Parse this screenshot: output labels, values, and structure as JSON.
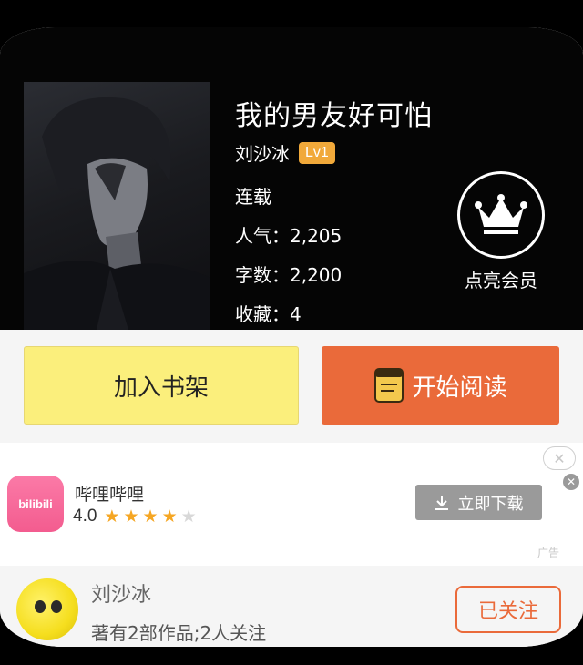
{
  "book": {
    "title": "我的男友好可怕",
    "author": "刘沙冰",
    "level_badge": "Lv1",
    "status": "连载",
    "popularity": "人气：2,205",
    "word_count": "字数：2,200",
    "favorites": "收藏：4",
    "cover_icon": "cover-art"
  },
  "vip": {
    "label": "点亮会员",
    "icon": "crown-icon"
  },
  "actions": {
    "add_shelf_label": "加入书架",
    "start_read_label": "开始阅读",
    "read_icon": "book-icon"
  },
  "ad": {
    "app_icon_text": "bilibili",
    "app_name": "哔哩哔哩",
    "rating": "4.0",
    "stars_filled": 4,
    "stars_total": 5,
    "download_label": "立即下载",
    "tag": "广告",
    "close_icon": "close-icon"
  },
  "author_strip": {
    "name": "刘沙冰",
    "subtitle": "著有2部作品;2人关注",
    "follow_label": "已关注"
  },
  "colors": {
    "accent_orange": "#ea6a3a",
    "shelf_yellow": "#fbef7c",
    "badge_orange": "#f1a93a",
    "star": "#f5a623"
  }
}
